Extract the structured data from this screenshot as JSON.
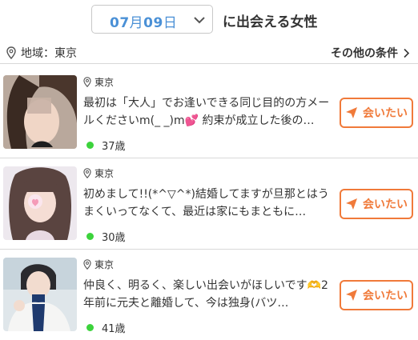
{
  "header": {
    "date_month": "07",
    "month_unit": "月",
    "date_day": "09",
    "day_unit": "日",
    "title": "に出会える女性"
  },
  "filter": {
    "region": "地域：東京",
    "other_conditions": "その他の条件"
  },
  "colors": {
    "accent": "#4a90d6",
    "button": "#f07a3a",
    "online": "#3cd33c"
  },
  "icons": {
    "location": "map-pin-icon",
    "chevron": "chevron-down-icon",
    "send": "paper-plane-icon"
  },
  "profiles": [
    {
      "location": "東京",
      "message": "最初は「大人」でお逢いできる同じ目的の方メールくださいm(_ _)m💕 約束が成立した後の…",
      "age": "37歳",
      "button": "会いたい"
    },
    {
      "location": "東京",
      "message": "初めまして!!(*^▽^*)結婚してますが旦那とはうまくいってなくて、最近は家にもまともに…",
      "age": "30歳",
      "button": "会いたい"
    },
    {
      "location": "東京",
      "message": "仲良く、明るく、楽しい出会いがほしいです🫶2年前に元夫と離婚して、今は独身(バツ…",
      "age": "41歳",
      "button": "会いたい"
    }
  ]
}
